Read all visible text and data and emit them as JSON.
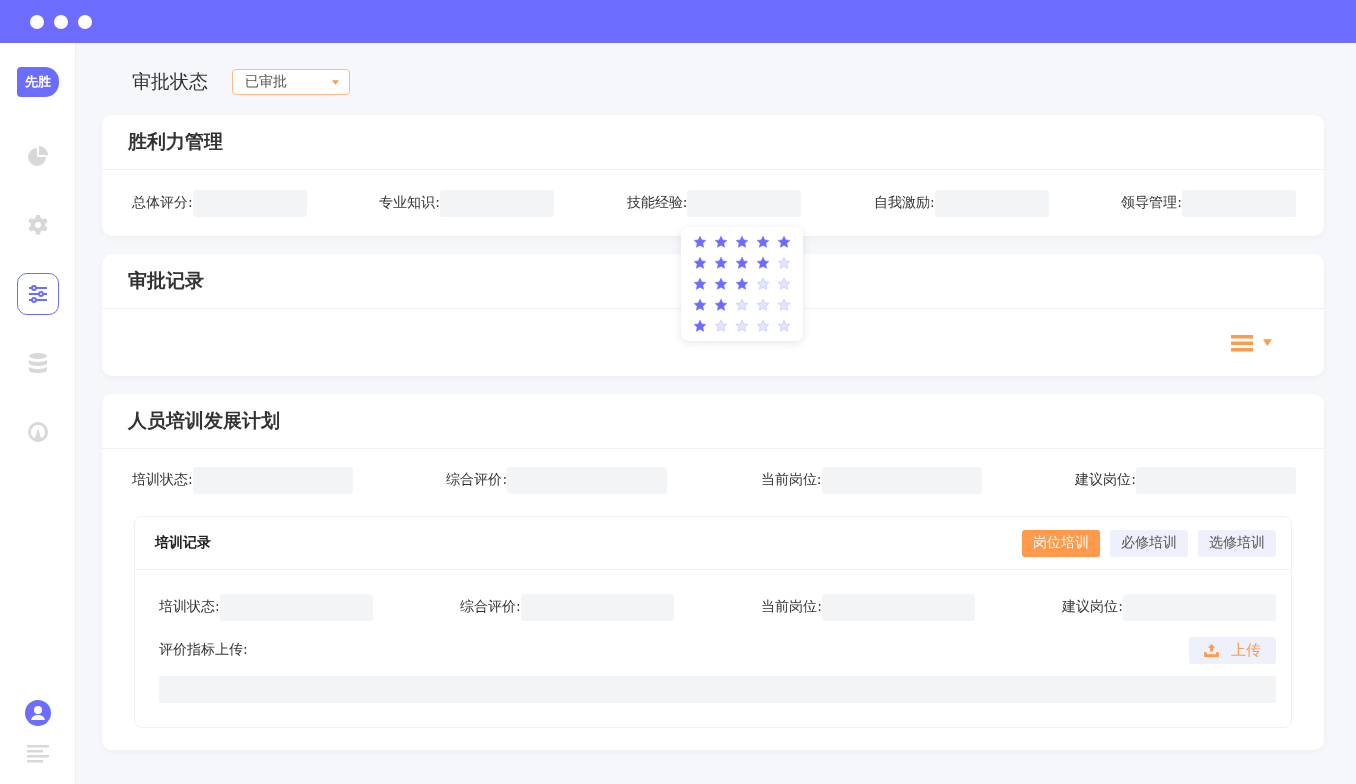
{
  "sidebar": {
    "logo": "先胜",
    "items": [
      {
        "kind": "chart",
        "selected": false
      },
      {
        "kind": "gear",
        "selected": false
      },
      {
        "kind": "sliders",
        "selected": true
      },
      {
        "kind": "database",
        "selected": false
      },
      {
        "kind": "gauge",
        "selected": false
      }
    ],
    "bottom": [
      {
        "kind": "user"
      },
      {
        "kind": "lines"
      }
    ]
  },
  "approval": {
    "label": "审批状态",
    "value": "已审批"
  },
  "win_mgmt": {
    "title": "胜利力管理",
    "fields": [
      {
        "label": "总体评分:"
      },
      {
        "label": "专业知识:"
      },
      {
        "label": "技能经验:",
        "rating_options": [
          {
            "stars": 5
          },
          {
            "stars": 4
          },
          {
            "stars": 3
          },
          {
            "stars": 2
          },
          {
            "stars": 1
          }
        ]
      },
      {
        "label": "自我激励:"
      },
      {
        "label": "领导管理:"
      }
    ]
  },
  "records": {
    "title": "审批记录"
  },
  "training": {
    "title": "人员培训发展计划",
    "fields": [
      {
        "label": "培训状态:"
      },
      {
        "label": "综合评价:"
      },
      {
        "label": "当前岗位:"
      },
      {
        "label": "建议岗位:"
      }
    ],
    "sub": {
      "title": "培训记录",
      "tabs": [
        {
          "label": "岗位培训",
          "selected": true
        },
        {
          "label": "必修培训",
          "selected": false
        },
        {
          "label": "选修培训",
          "selected": false
        }
      ],
      "fields": [
        {
          "label": "培训状态:"
        },
        {
          "label": "综合评价:"
        },
        {
          "label": "当前岗位:"
        },
        {
          "label": "建议岗位:"
        }
      ],
      "upload_label": "评价指标上传:",
      "upload_button": "上传"
    }
  }
}
